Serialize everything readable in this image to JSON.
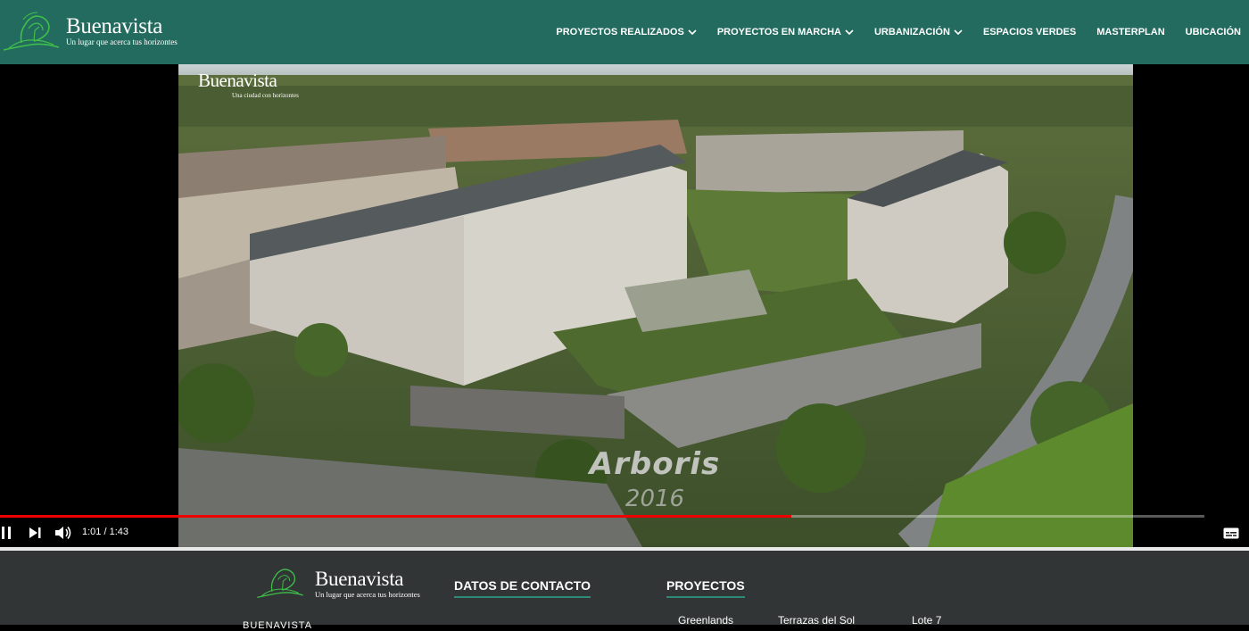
{
  "brand": {
    "name": "Buenavista",
    "tagline": "Un lugar que acerca tus horizontes"
  },
  "nav": {
    "items": [
      {
        "label": "PROYECTOS REALIZADOS",
        "has_dropdown": true
      },
      {
        "label": "PROYECTOS EN MARCHA",
        "has_dropdown": true
      },
      {
        "label": "URBANIZACIÓN",
        "has_dropdown": true
      },
      {
        "label": "ESPACIOS VERDES",
        "has_dropdown": false
      },
      {
        "label": "MASTERPLAN",
        "has_dropdown": false
      },
      {
        "label": "UBICACIÓN",
        "has_dropdown": false
      }
    ]
  },
  "video": {
    "watermark_name": "Buenavista",
    "watermark_tag": "Una ciudad con horizontes",
    "caption_title": "Arboris",
    "caption_year": "2016",
    "time_display": "1:01 / 1:43",
    "progress_fraction": 0.657,
    "icons": {
      "play_pause": "pause-icon",
      "next": "next-icon",
      "volume": "volume-icon",
      "subtitles": "subtitles-icon"
    }
  },
  "footer": {
    "contact_heading": "DATOS DE CONTACTO",
    "projects_heading": "PROYECTOS",
    "cut_text": "BUENAVISTA",
    "projects": [
      "Greenlands",
      "Terrazas del Sol",
      "Lote 7"
    ]
  },
  "colors": {
    "header_bg": "#226b5e",
    "footer_bg": "#313535",
    "accent_underline": "#2e8a76",
    "progress": "#e00000",
    "logo_green": "#3fbf4a"
  }
}
